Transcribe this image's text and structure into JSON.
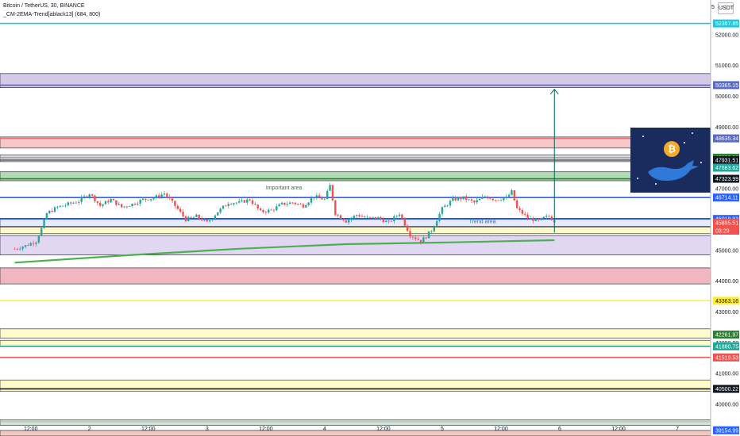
{
  "header": {
    "title": "Bitcoin / TetherUS, 30, BINANCE",
    "indicator": "_CM-2EMA-Trend[ablack13] (684, 800)",
    "currency": "USDT",
    "currency_prefix": "5"
  },
  "countdown": "03:29",
  "chart_data": {
    "type": "candlestick",
    "title": "Bitcoin / TetherUS, 30, BINANCE",
    "xlabel": "",
    "ylabel": "",
    "ylim": [
      38970,
      53130
    ],
    "grid": false,
    "y_ticks": [
      52000,
      51000,
      50000,
      49000,
      48000,
      47000,
      46000,
      45000,
      44000,
      43000,
      42000,
      41000,
      40000
    ],
    "x_ticks": [
      {
        "label": "12:00",
        "t": 1
      },
      {
        "label": "2",
        "t": 12
      },
      {
        "label": "12:00",
        "t": 23
      },
      {
        "label": "3",
        "t": 34
      },
      {
        "label": "12:00",
        "t": 45
      },
      {
        "label": "4",
        "t": 56
      },
      {
        "label": "12:00",
        "t": 67
      },
      {
        "label": "5",
        "t": 78
      },
      {
        "label": "12:00",
        "t": 89
      },
      {
        "label": "6",
        "t": 100
      },
      {
        "label": "12:00",
        "t": 111
      },
      {
        "label": "7",
        "t": 122
      },
      {
        "label": "12:00",
        "t": 133
      }
    ],
    "price_path": [
      [
        -2,
        45050
      ],
      [
        0,
        45150
      ],
      [
        2,
        45300
      ],
      [
        3,
        45700
      ],
      [
        4,
        46200
      ],
      [
        6,
        46400
      ],
      [
        8,
        46500
      ],
      [
        10,
        46600
      ],
      [
        12,
        46850
      ],
      [
        14,
        46450
      ],
      [
        16,
        46650
      ],
      [
        18,
        46400
      ],
      [
        20,
        46500
      ],
      [
        22,
        46650
      ],
      [
        24,
        46700
      ],
      [
        26,
        46850
      ],
      [
        28,
        46450
      ],
      [
        30,
        46000
      ],
      [
        32,
        46100
      ],
      [
        34,
        45900
      ],
      [
        36,
        46250
      ],
      [
        38,
        46550
      ],
      [
        40,
        46550
      ],
      [
        42,
        46650
      ],
      [
        44,
        46250
      ],
      [
        46,
        46300
      ],
      [
        48,
        46500
      ],
      [
        50,
        46550
      ],
      [
        52,
        46450
      ],
      [
        54,
        46750
      ],
      [
        56,
        46650
      ],
      [
        57,
        47100
      ],
      [
        58,
        46200
      ],
      [
        60,
        45950
      ],
      [
        62,
        46150
      ],
      [
        64,
        46050
      ],
      [
        66,
        46050
      ],
      [
        68,
        45900
      ],
      [
        70,
        46200
      ],
      [
        72,
        45500
      ],
      [
        74,
        45300
      ],
      [
        75,
        45450
      ],
      [
        76,
        45650
      ],
      [
        78,
        46350
      ],
      [
        80,
        46650
      ],
      [
        82,
        46700
      ],
      [
        84,
        46550
      ],
      [
        86,
        46750
      ],
      [
        88,
        46650
      ],
      [
        90,
        46700
      ],
      [
        91,
        46900
      ],
      [
        92,
        46350
      ],
      [
        94,
        46050
      ],
      [
        96,
        45950
      ],
      [
        97,
        46050
      ],
      [
        98,
        46100
      ],
      [
        99,
        45950
      ]
    ],
    "series": [
      {
        "name": "",
        "color": "#4caf50",
        "values": [
          [
            -2,
            44600
          ],
          [
            20,
            44850
          ],
          [
            40,
            45050
          ],
          [
            60,
            45200
          ],
          [
            80,
            45260
          ],
          [
            99,
            45330
          ]
        ]
      }
    ],
    "zones": [
      {
        "low": 50280,
        "high": 50740,
        "color": "#b39ddb"
      },
      {
        "low": 48320,
        "high": 48680,
        "color": "#ef9a9a"
      },
      {
        "low": 47880,
        "high": 48100,
        "color": "#c6c9d1"
      },
      {
        "low": 47260,
        "high": 47550,
        "color": "#6fbf73"
      },
      {
        "low": 45780,
        "high": 46040,
        "color": "#d7d9ff"
      },
      {
        "low": 45540,
        "high": 45760,
        "color": "#fff59d"
      },
      {
        "low": 44850,
        "high": 45480,
        "color": "#c9b6e8"
      },
      {
        "low": 43910,
        "high": 44430,
        "color": "#e57a8e"
      },
      {
        "low": 42150,
        "high": 42450,
        "color": "#fff59d"
      },
      {
        "low": 41880,
        "high": 42080,
        "color": "#fff59d"
      },
      {
        "low": 40420,
        "high": 40780,
        "color": "#fff59d"
      },
      {
        "low": 39320,
        "high": 39490,
        "color": "#a5d6a7"
      },
      {
        "low": 38970,
        "high": 39150,
        "color": "#e39a86"
      }
    ],
    "levels": [
      {
        "price": 52367.85,
        "color": "#26c6da"
      },
      {
        "price": 50365.15,
        "color": "#5c6bc0"
      },
      {
        "price": 48635.34,
        "color": "#e57373"
      },
      {
        "price": 48009.32,
        "color": "#9e9e9e"
      },
      {
        "price": 47931.51,
        "color": "#616161"
      },
      {
        "price": 47323.99,
        "color": "#2e7d32"
      },
      {
        "price": 46714.11,
        "color": "#2962ff"
      },
      {
        "price": 46019.93,
        "color": "#2962ff"
      },
      {
        "price": 43363.16,
        "color": "#ffeb3b"
      },
      {
        "price": 41880.75,
        "color": "#26a69a"
      },
      {
        "price": 41519.53,
        "color": "#ef5350"
      },
      {
        "price": 40500.22,
        "color": "#212121"
      }
    ],
    "price_labels": [
      {
        "text": "52367.85",
        "price": 52367.85,
        "bg": "#26c6da",
        "fg": "#ffffff"
      },
      {
        "text": "50365.15",
        "price": 50365.15,
        "bg": "#5c6bc0",
        "fg": "#ffffff"
      },
      {
        "text": "48635.34",
        "price": 48635.34,
        "bg": "#5c6bc0",
        "fg": "#ffffff"
      },
      {
        "text": "48009.32",
        "price": 48009.32,
        "bg": "#2e7d32",
        "fg": "#ffffff"
      },
      {
        "text": "47931.51",
        "price": 47931.51,
        "bg": "#131722",
        "fg": "#ffffff"
      },
      {
        "text": "47683.62",
        "price": 47683.62,
        "bg": "#26a69a",
        "fg": "#ffffff"
      },
      {
        "text": "47323.99",
        "price": 47323.99,
        "bg": "#131722",
        "fg": "#ffffff"
      },
      {
        "text": "46714.11",
        "price": 46714.11,
        "bg": "#2962ff",
        "fg": "#ffffff"
      },
      {
        "text": "46019.93",
        "price": 46019.93,
        "bg": "#2962ff",
        "fg": "#ffffff"
      },
      {
        "text": "45895.51",
        "price": 45895.51,
        "bg": "#ef5350",
        "fg": "#ffffff"
      },
      {
        "text": "43363.16",
        "price": 43363.16,
        "bg": "#ffeb3b",
        "fg": "#131722"
      },
      {
        "text": "42261.97",
        "price": 42261.97,
        "bg": "#2e7d32",
        "fg": "#ffffff"
      },
      {
        "text": "41880.75",
        "price": 41880.75,
        "bg": "#26a69a",
        "fg": "#ffffff"
      },
      {
        "text": "41519.53",
        "price": 41519.53,
        "bg": "#ef5350",
        "fg": "#ffffff"
      },
      {
        "text": "40500.22",
        "price": 40500.22,
        "bg": "#131722",
        "fg": "#ffffff"
      },
      {
        "text": "39154.99",
        "price": 39154.99,
        "bg": "#2962ff",
        "fg": "#ffffff"
      }
    ],
    "annotations": [
      {
        "text": "Important area",
        "t": 45,
        "price": 46980,
        "color": "#2e7d32"
      },
      {
        "text": "Trend area",
        "t": 83,
        "price": 45880,
        "color": "#00897b"
      }
    ],
    "target_arrow": {
      "t": 99,
      "from": 45580,
      "to": 50230,
      "color": "#00695c"
    }
  },
  "colors": {
    "up": "#26a69a",
    "down": "#ef5350",
    "axis_text": "#131722",
    "border": "#b2b5be",
    "logo_bg": "#1a2b5e"
  }
}
